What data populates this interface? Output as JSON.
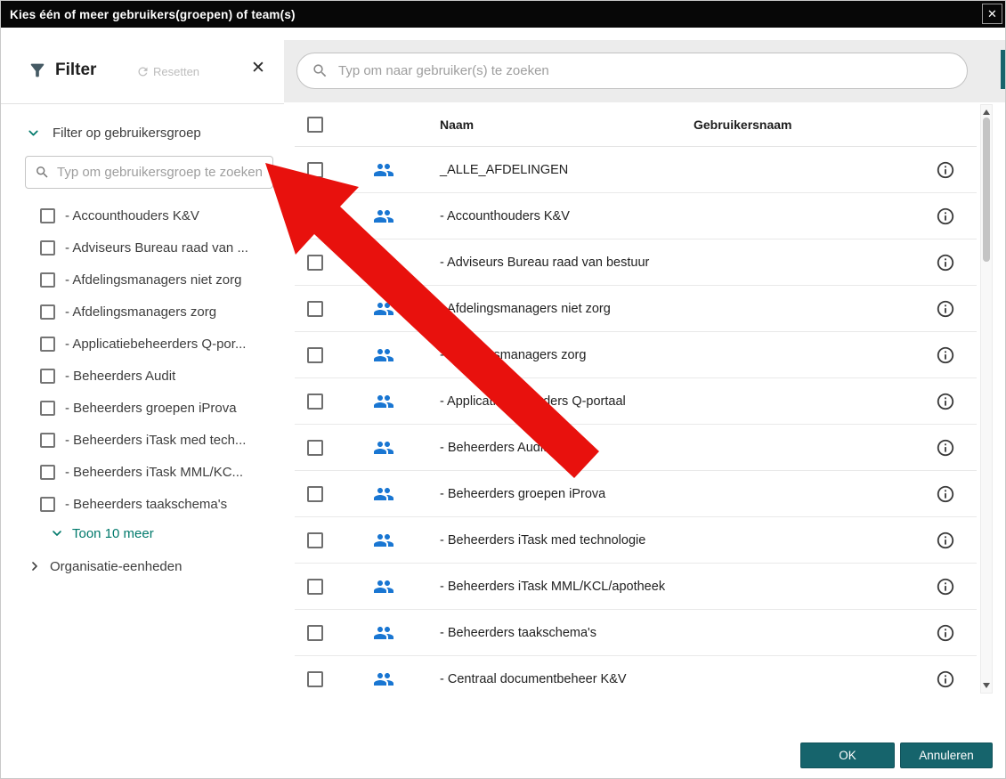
{
  "dialog": {
    "title": "Kies één of meer gebruikers(groepen) of team(s)",
    "close_glyph": "✕"
  },
  "filter_panel": {
    "title": "Filter",
    "reset_label": "Resetten",
    "close_glyph": "✕",
    "group_section_label": "Filter op gebruikersgroep",
    "group_search_placeholder": "Typ om gebruikersgroep te zoeken",
    "groups": [
      "- Accounthouders K&V",
      "- Adviseurs Bureau raad van ...",
      "- Afdelingsmanagers niet zorg",
      "- Afdelingsmanagers zorg",
      "- Applicatiebeheerders Q-por...",
      "- Beheerders Audit",
      "- Beheerders groepen iProva",
      "- Beheerders iTask med tech...",
      "- Beheerders iTask MML/KC...",
      "- Beheerders taakschema's"
    ],
    "show_more_label": "Toon 10 meer",
    "org_section_label": "Organisatie-eenheden"
  },
  "main": {
    "user_search_placeholder": "Typ om naar gebruiker(s) te zoeken",
    "columns": {
      "name": "Naam",
      "username": "Gebruikersnaam"
    },
    "rows": [
      "_ALLE_AFDELINGEN",
      "- Accounthouders K&V",
      "- Adviseurs Bureau raad van bestuur",
      "- Afdelingsmanagers niet zorg",
      "- Afdelingsmanagers zorg",
      "- Applicatiebeheerders Q-portaal",
      "- Beheerders Audit",
      "- Beheerders groepen iProva",
      "- Beheerders iTask med technologie",
      "- Beheerders iTask MML/KCL/apotheek",
      "- Beheerders taakschema's",
      "- Centraal documentbeheer K&V"
    ]
  },
  "footer": {
    "ok_label": "OK",
    "cancel_label": "Annuleren"
  },
  "colors": {
    "accent_teal": "#16646c",
    "icon_blue": "#1976d2",
    "link_teal": "#00796b",
    "arrow_red": "#e8110d"
  }
}
